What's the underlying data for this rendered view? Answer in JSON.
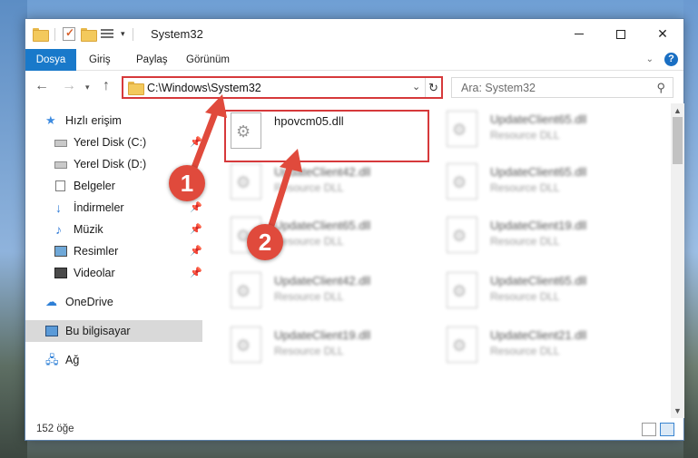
{
  "window": {
    "title": "System32",
    "qat_arrow": "▾"
  },
  "ribbon": {
    "tabs": [
      "Dosya",
      "Giriş",
      "Paylaş",
      "Görünüm"
    ],
    "help": "?",
    "collapse": "⌄"
  },
  "nav": {
    "address": "C:\\Windows\\System32",
    "search_placeholder": "Ara: System32"
  },
  "sidebar": {
    "quick_access": "Hızlı erişim",
    "items": [
      {
        "label": "Yerel Disk (C:)",
        "pinned": true
      },
      {
        "label": "Yerel Disk (D:)",
        "pinned": false
      },
      {
        "label": "Belgeler",
        "pinned": true
      },
      {
        "label": "İndirmeler",
        "pinned": true
      },
      {
        "label": "Müzik",
        "pinned": true
      },
      {
        "label": "Resimler",
        "pinned": true
      },
      {
        "label": "Videolar",
        "pinned": true
      }
    ],
    "onedrive": "OneDrive",
    "this_pc": "Bu bilgisayar",
    "network": "Ağ"
  },
  "files": {
    "highlighted": {
      "name": "hpovcm05.dll"
    },
    "left_column": [
      {
        "name": "UpdateClient42.dll",
        "type": "Resource DLL"
      },
      {
        "name": "UpdateClient65.dll",
        "type": "Resource DLL"
      },
      {
        "name": "UpdateClient42.dll",
        "type": "Resource DLL"
      },
      {
        "name": "UpdateClient19.dll",
        "type": "Resource DLL"
      }
    ],
    "right_column": [
      {
        "name": "UpdateClient65.dll",
        "type": "Resource DLL"
      },
      {
        "name": "UpdateClient65.dll",
        "type": "Resource DLL"
      },
      {
        "name": "UpdateClient19.dll",
        "type": "Resource DLL"
      },
      {
        "name": "UpdateClient65.dll",
        "type": "Resource DLL"
      },
      {
        "name": "UpdateClient21.dll",
        "type": "Resource DLL"
      }
    ]
  },
  "status": {
    "item_count": "152 öğe"
  },
  "callouts": {
    "first": "1",
    "second": "2"
  },
  "colors": {
    "accent": "#1979ca",
    "highlight_red": "#d6393b",
    "callout_red": "#e04a3c"
  }
}
